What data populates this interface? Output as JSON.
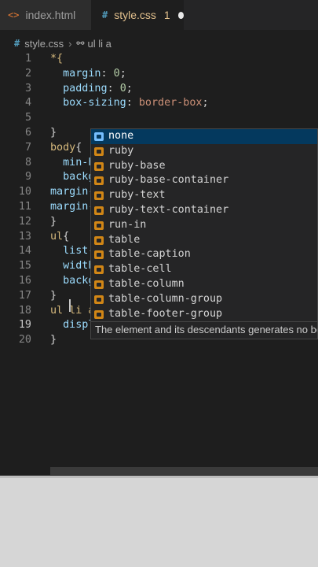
{
  "tabs": [
    {
      "label": "index.html",
      "icon": "html-file-icon"
    },
    {
      "label": "style.css",
      "icon": "css-file-icon",
      "problems": "1",
      "modified": true
    }
  ],
  "breadcrumb": {
    "file": "style.css",
    "symbol": "ul li a"
  },
  "code": [
    {
      "n": "1",
      "parts": [
        [
          "sel",
          "*{"
        ]
      ]
    },
    {
      "n": "2",
      "parts": [
        [
          "prop",
          "  margin"
        ],
        [
          "pun",
          ": "
        ],
        [
          "num",
          "0"
        ],
        [
          "pun",
          ";"
        ]
      ]
    },
    {
      "n": "3",
      "parts": [
        [
          "prop",
          "  padding"
        ],
        [
          "pun",
          ": "
        ],
        [
          "num",
          "0"
        ],
        [
          "pun",
          ";"
        ]
      ]
    },
    {
      "n": "4",
      "parts": [
        [
          "prop",
          "  box-sizing"
        ],
        [
          "pun",
          ": "
        ],
        [
          "val",
          "border-box"
        ],
        [
          "pun",
          ";"
        ]
      ]
    },
    {
      "n": "5",
      "parts": []
    },
    {
      "n": "6",
      "parts": [
        [
          "pun",
          "}"
        ]
      ]
    },
    {
      "n": "7",
      "parts": [
        [
          "sel",
          "body"
        ],
        [
          "pun",
          "{"
        ]
      ]
    },
    {
      "n": "8",
      "parts": [
        [
          "prop",
          "  min-h"
        ]
      ]
    },
    {
      "n": "9",
      "parts": [
        [
          "prop",
          "  backg"
        ]
      ]
    },
    {
      "n": "10",
      "parts": [
        [
          "prop",
          "margin-"
        ]
      ]
    },
    {
      "n": "11",
      "parts": [
        [
          "prop",
          "margin-"
        ]
      ]
    },
    {
      "n": "12",
      "parts": [
        [
          "pun",
          "}"
        ]
      ]
    },
    {
      "n": "13",
      "parts": [
        [
          "sel",
          "ul"
        ],
        [
          "pun",
          "{"
        ]
      ]
    },
    {
      "n": "14",
      "parts": [
        [
          "prop",
          "  list-"
        ]
      ]
    },
    {
      "n": "15",
      "parts": [
        [
          "prop",
          "  width"
        ]
      ]
    },
    {
      "n": "16",
      "parts": [
        [
          "prop",
          "  backg"
        ]
      ]
    },
    {
      "n": "17",
      "parts": [
        [
          "pun",
          "}"
        ]
      ]
    },
    {
      "n": "18",
      "parts": [
        [
          "sel",
          "ul li a"
        ]
      ]
    },
    {
      "n": "19",
      "parts": [
        [
          "prop",
          "  displ"
        ]
      ],
      "active": true
    },
    {
      "n": "20",
      "parts": [
        [
          "pun",
          "}"
        ]
      ]
    }
  ],
  "suggestions": [
    {
      "label": "none",
      "selected": true
    },
    {
      "label": "ruby"
    },
    {
      "label": "ruby-base"
    },
    {
      "label": "ruby-base-container"
    },
    {
      "label": "ruby-text"
    },
    {
      "label": "ruby-text-container"
    },
    {
      "label": "run-in"
    },
    {
      "label": "table"
    },
    {
      "label": "table-caption"
    },
    {
      "label": "table-cell"
    },
    {
      "label": "table-column"
    },
    {
      "label": "table-column-group"
    },
    {
      "label": "table-footer-group"
    }
  ],
  "detail": "The element and its descendants generates no boxes.",
  "colors": {
    "editor_bg": "#1e1e1e",
    "selected_item": "#04395e",
    "property_icon": "#d18616"
  }
}
